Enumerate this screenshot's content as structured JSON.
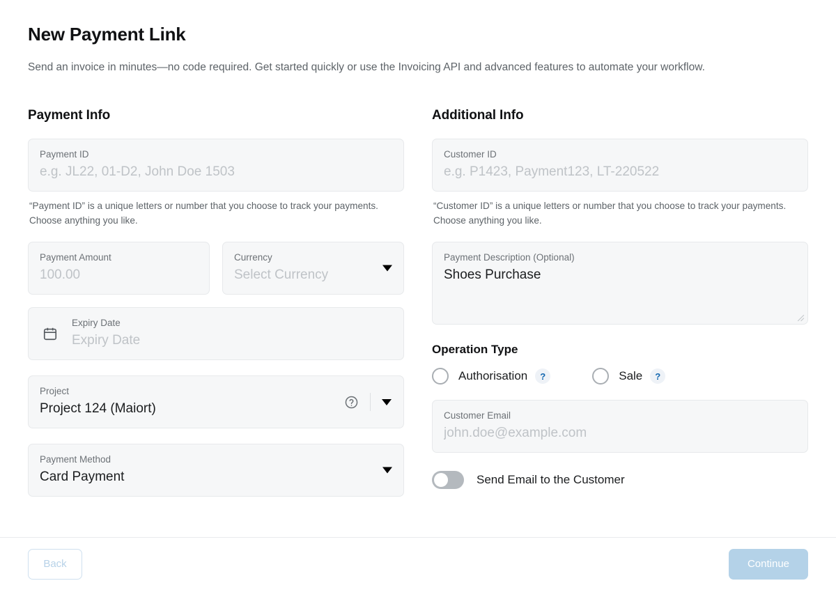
{
  "header": {
    "title": "New Payment Link",
    "subtitle": "Send an invoice in minutes—no code required. Get started quickly or use the Invoicing API and advanced features to automate your workflow."
  },
  "payment_info": {
    "section_title": "Payment Info",
    "payment_id": {
      "label": "Payment ID",
      "placeholder": "e.g. JL22, 01-D2, John Doe 1503",
      "value": "",
      "helper": "“Payment ID” is a unique letters or number that you choose to track your payments. Choose anything you like."
    },
    "payment_amount": {
      "label": "Payment Amount",
      "placeholder": "100.00",
      "value": ""
    },
    "currency": {
      "label": "Currency",
      "placeholder": "Select Currency",
      "value": ""
    },
    "expiry_date": {
      "label": "Expiry Date",
      "placeholder": "Expiry Date",
      "value": "",
      "icon": "calendar-icon"
    },
    "project": {
      "label": "Project",
      "value": "Project 124 (Maiort)",
      "help_icon": "question-circle-icon"
    },
    "payment_method": {
      "label": "Payment Method",
      "value": "Card Payment"
    }
  },
  "additional_info": {
    "section_title": "Additional Info",
    "customer_id": {
      "label": "Customer ID",
      "placeholder": "e.g. P1423, Payment123, LT-220522",
      "value": "",
      "helper": "“Customer ID” is a unique letters or number that you choose to track your payments. Choose anything you like."
    },
    "payment_description": {
      "label": "Payment Description (Optional)",
      "value": "Shoes Purchase"
    },
    "operation_type": {
      "title": "Operation Type",
      "options": [
        {
          "label": "Authorisation",
          "selected": false,
          "help": "?"
        },
        {
          "label": "Sale",
          "selected": false,
          "help": "?"
        }
      ]
    },
    "customer_email": {
      "label": "Customer Email",
      "placeholder": "john.doe@example.com",
      "value": ""
    },
    "send_email_toggle": {
      "label": "Send Email to the Customer",
      "enabled": false
    }
  },
  "footer": {
    "back_label": "Back",
    "continue_label": "Continue"
  },
  "colors": {
    "field_bg": "#f6f7f8",
    "field_border": "#e7e9eb",
    "accent_disabled": "#b4d2e8",
    "help_badge_text": "#1568b0",
    "help_badge_bg": "#eef2f7",
    "toggle_off": "#b4b9be"
  }
}
